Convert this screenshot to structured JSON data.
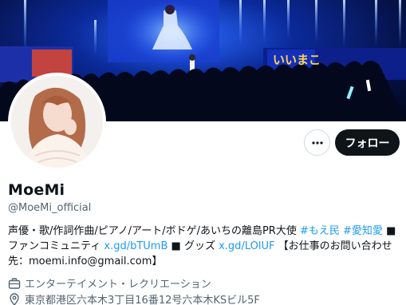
{
  "profile": {
    "display_name": "MoeMi",
    "handle": "@MoeMi_official",
    "follow_label": "フォロー",
    "bio": {
      "line1_text": "声優・歌/作詞作曲/ピアノ/アート/ボドゲ/あいちの離島PR大使",
      "hashtag1": "#もえ民",
      "hashtag2": "#愛知愛",
      "square1": "■",
      "fan_label": "ファンコミュニティ",
      "fan_link": "x.gd/bTUmB",
      "square2": "■",
      "goods_label": "グッズ",
      "goods_link": "x.gd/LOlUF",
      "contact_prefix": "【お仕事のお問い合わせ先：",
      "contact_email": "moemi.info@gmail.com",
      "contact_suffix": "】"
    },
    "category": "エンターテイメント・レクリエーション",
    "location": "東京都港区六本木3丁目16番12号六本木KSビル5F"
  },
  "banner": {
    "stage_sign_text": "いいまこ"
  },
  "icons": {
    "more": "more-dots-icon",
    "category": "briefcase-icon",
    "location": "location-pin-icon"
  },
  "colors": {
    "accent": "#1d9bf0",
    "button_dark": "#0f1419",
    "secondary_text": "#536471"
  }
}
